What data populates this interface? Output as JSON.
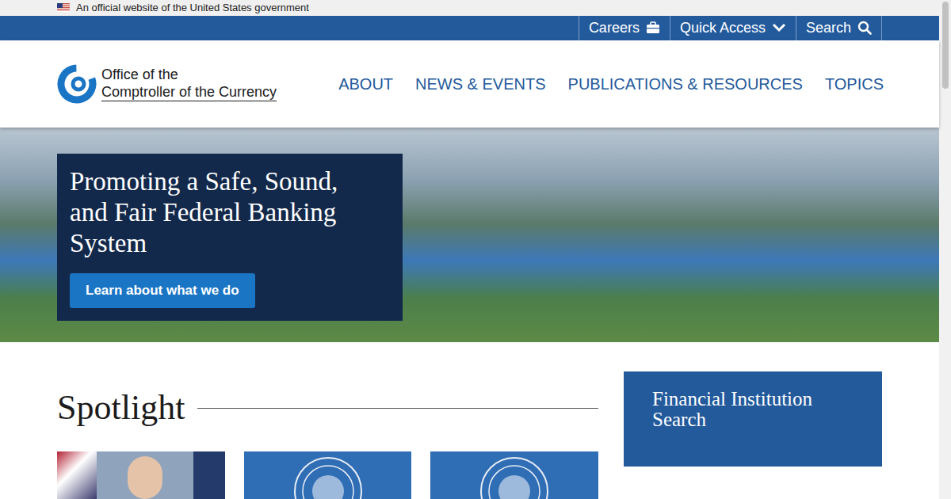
{
  "gov_banner": {
    "text": "An official website of the United States government"
  },
  "utility_bar": {
    "links": [
      {
        "label": "Careers",
        "kind": "briefcase"
      },
      {
        "label": "Quick Access",
        "kind": "chevron"
      },
      {
        "label": "Search",
        "kind": "search"
      }
    ]
  },
  "logo": {
    "lines": [
      "Office of the",
      "Comptroller of the Currency"
    ]
  },
  "nav": {
    "items": [
      {
        "label": "ABOUT"
      },
      {
        "label": "NEWS & EVENTS"
      },
      {
        "label": "PUBLICATIONS & RESOURCES"
      },
      {
        "label": "TOPICS"
      }
    ]
  },
  "hero": {
    "heading_lines": [
      "Promoting a Safe, Sound,",
      "and Fair Federal Banking",
      "System"
    ],
    "button": "Learn about what we do"
  },
  "spotlight": {
    "title": "Spotlight",
    "cards": [
      {
        "kind": "photo"
      },
      {
        "kind": "seal"
      },
      {
        "kind": "seal"
      }
    ]
  },
  "sidebar": {
    "title_lines": [
      "Financial Institution",
      "Search"
    ]
  }
}
